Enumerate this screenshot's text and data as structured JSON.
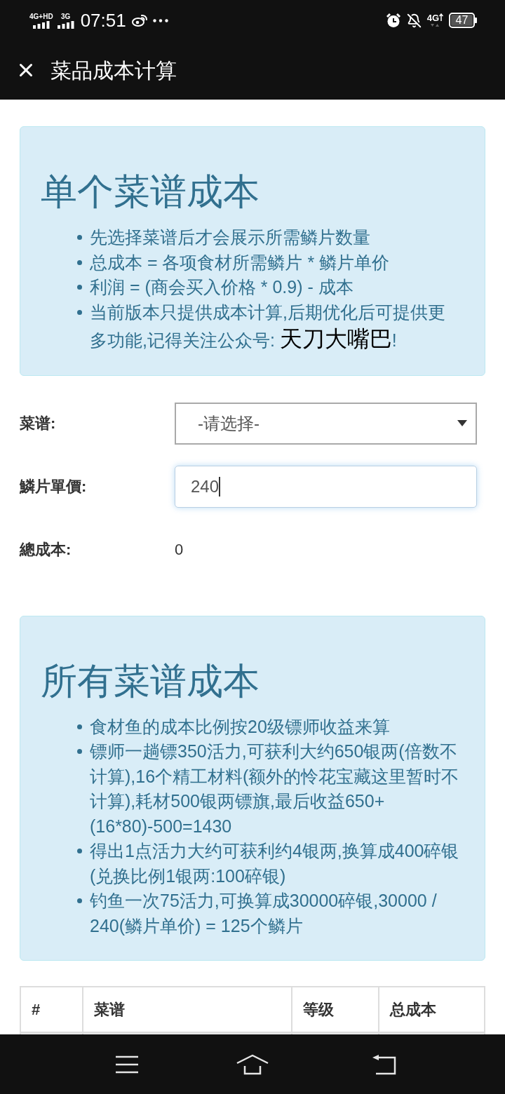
{
  "status_bar": {
    "network_1": "4G+HD",
    "network_2": "3G",
    "time": "07:51",
    "network_3": "4G",
    "battery": "47"
  },
  "header": {
    "title": "菜品成本计算"
  },
  "single_recipe": {
    "title": "单个菜谱成本",
    "notes": [
      {
        "text": "先选择菜谱后才会展示所需鳞片数量"
      },
      {
        "text": "总成本 = 各项食材所需鳞片 * 鳞片单价"
      },
      {
        "text": "利润 = (商会买入价格 * 0.9) - 成本"
      },
      {
        "text": "当前版本只提供成本计算,后期优化后可提供更多功能,记得关注公众号: ",
        "highlight": "天刀大嘴巴",
        "suffix": "!"
      }
    ],
    "form": [
      {
        "kind": "select",
        "label": "菜谱:",
        "value": "-请选择-"
      },
      {
        "kind": "input",
        "label": "鱗片單價:",
        "value": "240",
        "focused": true
      },
      {
        "kind": "output",
        "label": "總成本:",
        "value": "0"
      }
    ]
  },
  "all_recipes": {
    "title": "所有菜谱成本",
    "notes": [
      {
        "text": "食材鱼的成本比例按20级镖师收益来算"
      },
      {
        "text": "镖师一趟镖350活力,可获利大约650银两(倍数不计算),16个精工材料(额外的怜花宝藏这里暂时不计算),耗材500银两镖旗,最后收益650+(16*80)-500=1430"
      },
      {
        "text": "得出1点活力大约可获利约4银两,换算成400碎银(兑换比例1银两:100碎银)"
      },
      {
        "text": "钓鱼一次75活力,可换算成30000碎银,30000 / 240(鳞片单价) = 125个鳞片"
      }
    ],
    "table": {
      "columns": [
        "#",
        "菜谱",
        "等级",
        "总成本"
      ]
    }
  }
}
